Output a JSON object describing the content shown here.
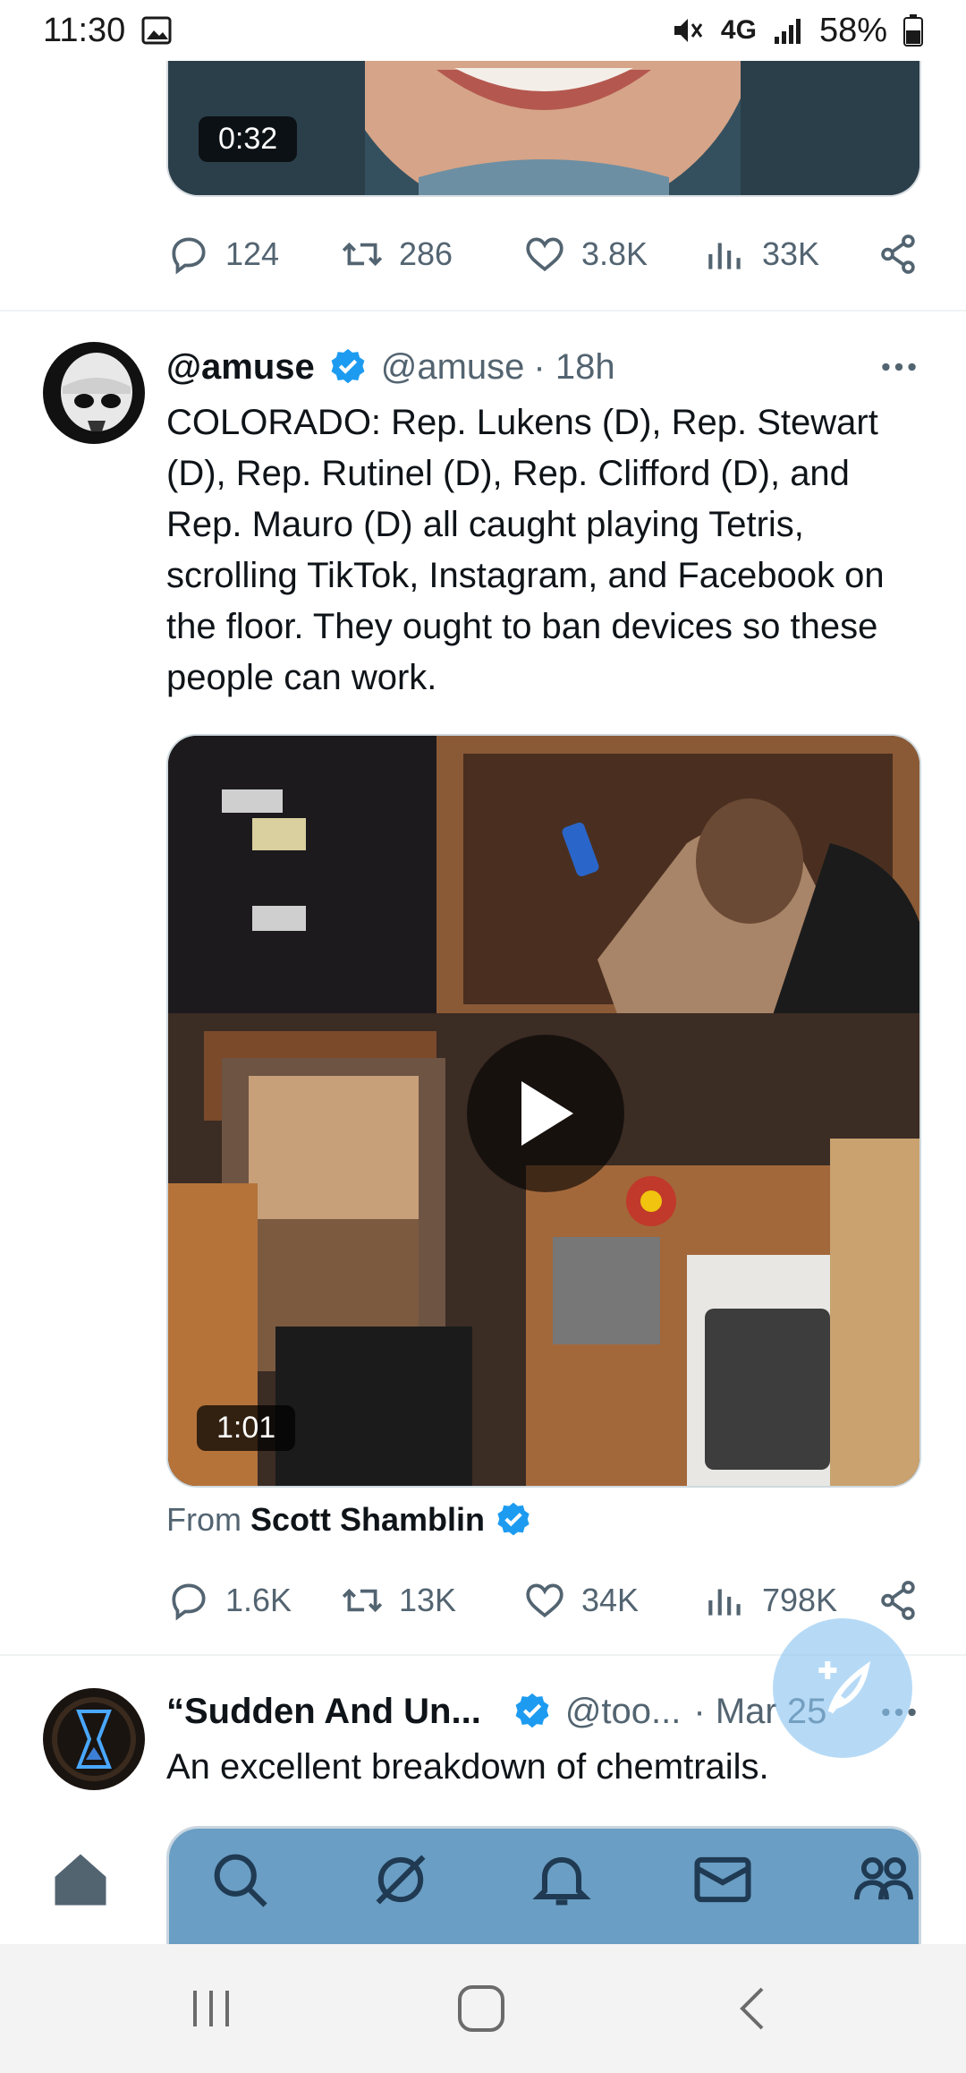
{
  "status_bar": {
    "time": "11:30",
    "network": "4G",
    "battery": "58%"
  },
  "prev_tweet": {
    "video_duration": "0:32",
    "replies": "124",
    "retweets": "286",
    "likes": "3.8K",
    "views": "33K"
  },
  "tweet": {
    "display_name": "@amuse",
    "handle": "@amuse",
    "time": "· 18h",
    "text": "COLORADO: Rep. Lukens (D), Rep. Stewart (D), Rep. Rutinel (D), Rep. Clifford (D), and Rep. Mauro (D) all caught playing Tetris, scrolling TikTok, Instagram, and Facebook on the floor. They ought to ban devices so these people can work.",
    "video_duration": "1:01",
    "from_label": "From",
    "from_source": "Scott Shamblin",
    "replies": "1.6K",
    "retweets": "13K",
    "likes": "34K",
    "views": "798K"
  },
  "next_tweet": {
    "display_name": "“Sudden And Un...",
    "handle": "@too...",
    "time": "· Mar 25",
    "text": "An excellent breakdown of chemtrails."
  },
  "icons": {
    "reply": "reply-icon",
    "retweet": "retweet-icon",
    "like": "heart-icon",
    "views": "views-icon",
    "share": "share-icon",
    "more": "more-icon",
    "verified": "verified-badge-icon",
    "compose": "compose-icon",
    "nav": [
      "home-icon",
      "search-icon",
      "spaces-icon",
      "bell-icon",
      "mail-icon",
      "communities-icon"
    ]
  },
  "colors": {
    "accent": "#1d9bf0",
    "muted_text": "#536471",
    "text": "#0f1419"
  }
}
